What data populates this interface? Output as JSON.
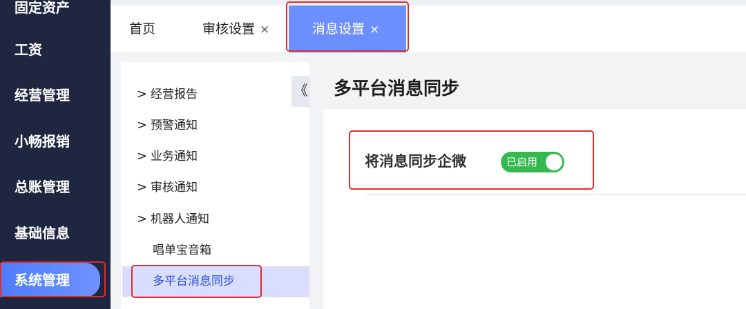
{
  "sidebar": {
    "items": [
      {
        "label": "固定资产"
      },
      {
        "label": "工资"
      },
      {
        "label": "经营管理"
      },
      {
        "label": "小畅报销"
      },
      {
        "label": "总账管理"
      },
      {
        "label": "基础信息"
      },
      {
        "label": "系统管理"
      }
    ]
  },
  "tabs": [
    {
      "label": "首页"
    },
    {
      "label": "审核设置",
      "close": "×"
    },
    {
      "label": "消息设置",
      "close": "×"
    }
  ],
  "tree": {
    "collapse_icon": "《",
    "items": [
      {
        "label": "经营报告",
        "chevron": ">"
      },
      {
        "label": "预警通知",
        "chevron": ">"
      },
      {
        "label": "业务通知",
        "chevron": ">"
      },
      {
        "label": "审核通知",
        "chevron": ">"
      },
      {
        "label": "机器人通知",
        "chevron": ">"
      },
      {
        "label": "唱单宝音箱"
      },
      {
        "label": "多平台消息同步"
      }
    ]
  },
  "main": {
    "title": "多平台消息同步",
    "setting": {
      "label": "将消息同步企微",
      "toggle_text": "已启用",
      "enabled": true
    }
  },
  "colors": {
    "sidebar_bg": "#1f2740",
    "accent": "#6c8fff",
    "toggle_on": "#35b84f",
    "highlight_box": "#e02b2b"
  }
}
